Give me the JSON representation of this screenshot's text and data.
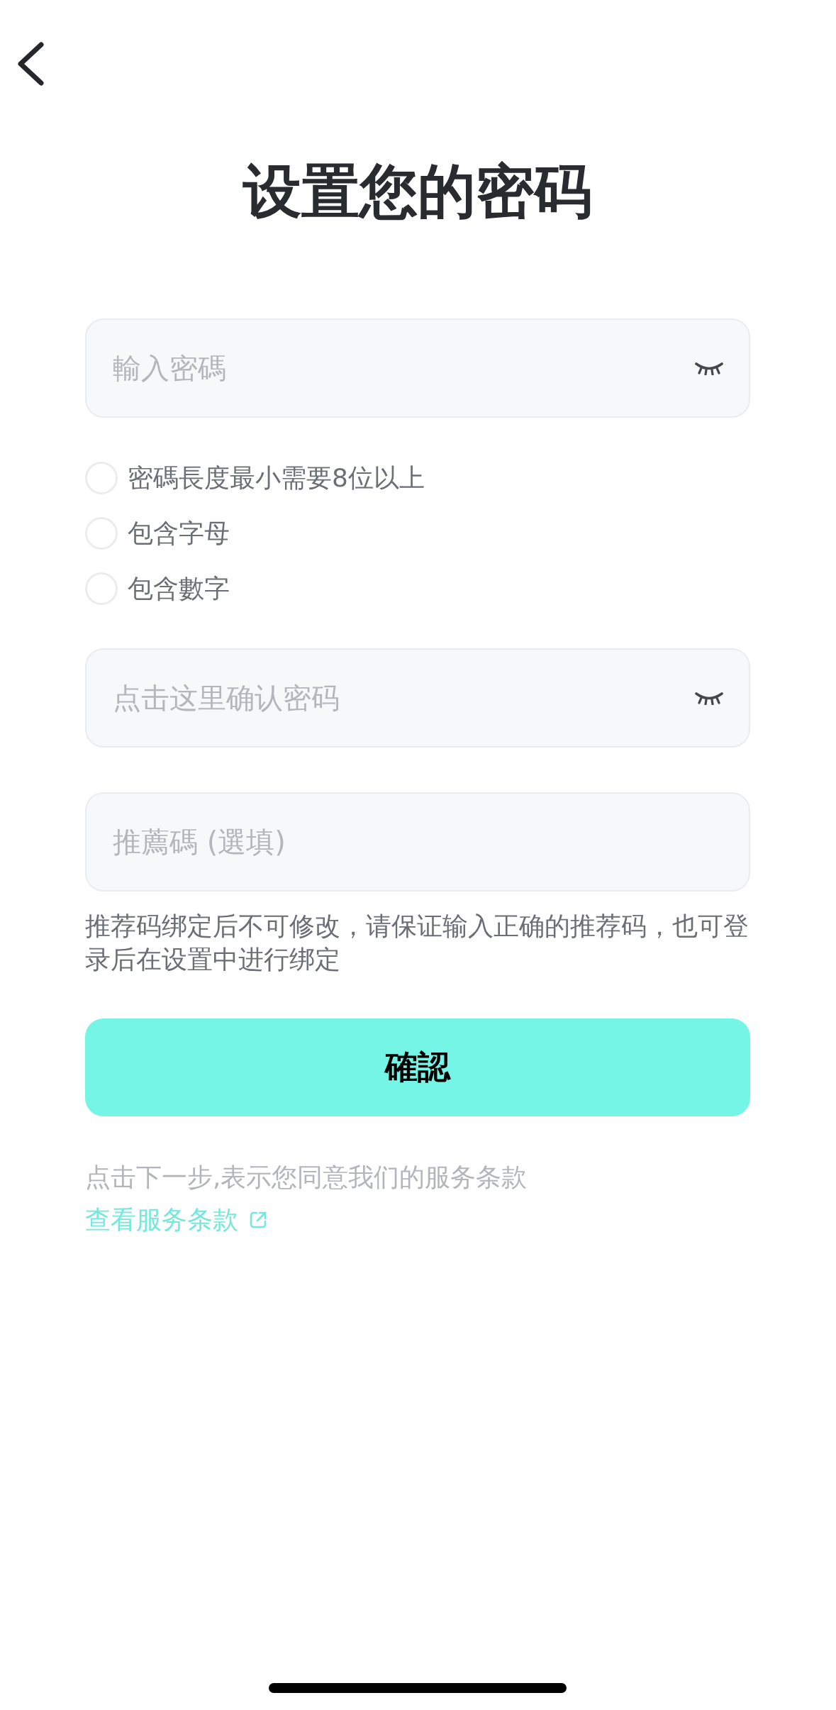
{
  "title": "设置您的密码",
  "password_field": {
    "placeholder": "輸入密碼",
    "revealed": false
  },
  "requirements": [
    {
      "label": "密碼長度最小需要8位以上",
      "checked": false
    },
    {
      "label": "包含字母",
      "checked": false
    },
    {
      "label": "包含數字",
      "checked": false
    }
  ],
  "confirm_field": {
    "placeholder": "点击这里确认密码",
    "revealed": false
  },
  "referral_field": {
    "placeholder": "推薦碼 (選填)"
  },
  "referral_note": "推荐码绑定后不可修改，请保证输入正确的推荐码，也可登录后在设置中进行绑定",
  "confirm_button": {
    "label": "確認"
  },
  "terms": {
    "text": "点击下一步,表示您同意我们的服务条款",
    "link": "查看服务条款"
  }
}
